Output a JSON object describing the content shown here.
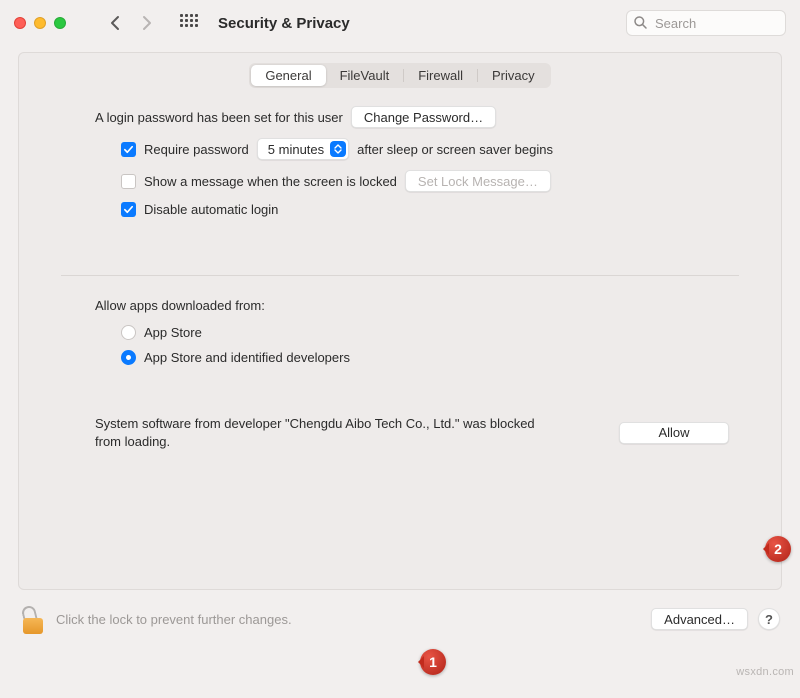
{
  "window": {
    "title": "Security & Privacy"
  },
  "search": {
    "placeholder": "Search"
  },
  "tabs": {
    "general": "General",
    "filevault": "FileVault",
    "firewall": "Firewall",
    "privacy": "Privacy"
  },
  "login": {
    "password_set_text": "A login password has been set for this user",
    "change_password_btn": "Change Password…",
    "require_password_label_before": "Require password",
    "require_password_duration": "5 minutes",
    "require_password_label_after": "after sleep or screen saver begins",
    "show_message_label": "Show a message when the screen is locked",
    "set_lock_message_btn": "Set Lock Message…",
    "disable_auto_login_label": "Disable automatic login"
  },
  "downloads": {
    "heading": "Allow apps downloaded from:",
    "app_store": "App Store",
    "identified": "App Store and identified developers"
  },
  "blocked": {
    "text": "System software from developer \"Chengdu Aibo Tech Co., Ltd.\" was blocked from loading.",
    "allow_btn": "Allow"
  },
  "footer": {
    "lock_text": "Click the lock to prevent further changes.",
    "advanced_btn": "Advanced…",
    "help": "?"
  },
  "annotations": {
    "a1": "1",
    "a2": "2"
  },
  "watermark": "wsxdn.com"
}
